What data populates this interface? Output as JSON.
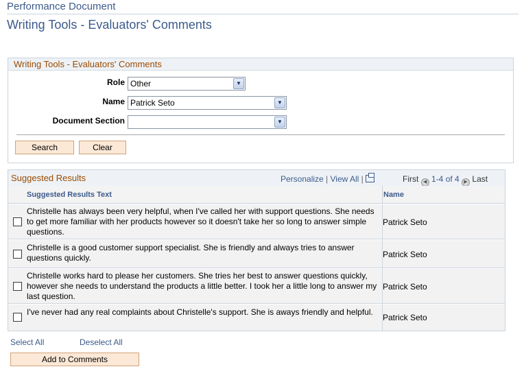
{
  "breadcrumb": "Performance Document",
  "page_title": "Writing Tools - Evaluators' Comments",
  "search": {
    "title": "Writing Tools - Evaluators' Comments",
    "role_label": "Role",
    "role_value": "Other",
    "name_label": "Name",
    "name_value": "Patrick Seto",
    "section_label": "Document Section",
    "section_value": "",
    "search_button": "Search",
    "clear_button": "Clear"
  },
  "results": {
    "title": "Suggested Results",
    "personalize": "Personalize",
    "separator": "|",
    "view_all": "View All",
    "first": "First",
    "range": "1-4 of 4",
    "last": "Last",
    "col_text": "Suggested Results Text",
    "col_name": "Name",
    "rows": [
      {
        "text": "Christelle has always been very helpful, when I've called her with support questions.  She needs to get more familiar with her products however so it doesn't take her so long to answer simple questions.",
        "name": "Patrick Seto"
      },
      {
        "text": "Christelle is a good customer support specialist.  She is friendly and always tries to answer questions quickly.",
        "name": "Patrick Seto"
      },
      {
        "text": "Christelle works hard to please her customers.  She tries her best to answer questions quickly, however she needs to understand the products a little better.  I took her a little long to answer my last question.",
        "name": "Patrick Seto"
      },
      {
        "text": "I've never had any real complaints about Christelle's support.  She is aways friendly and helpful.",
        "name": "Patrick Seto"
      }
    ]
  },
  "actions": {
    "select_all": "Select All",
    "deselect_all": "Deselect All",
    "add_to_comments": "Add to Comments"
  },
  "icons": {
    "dropdown": "chevron-down-icon",
    "new_window": "new-window-icon",
    "prev": "previous-arrow-icon",
    "next": "next-arrow-icon"
  },
  "colors": {
    "link": "#3c5a8b",
    "section_title": "#9a4a00",
    "button_bg": "#fce8d6"
  }
}
